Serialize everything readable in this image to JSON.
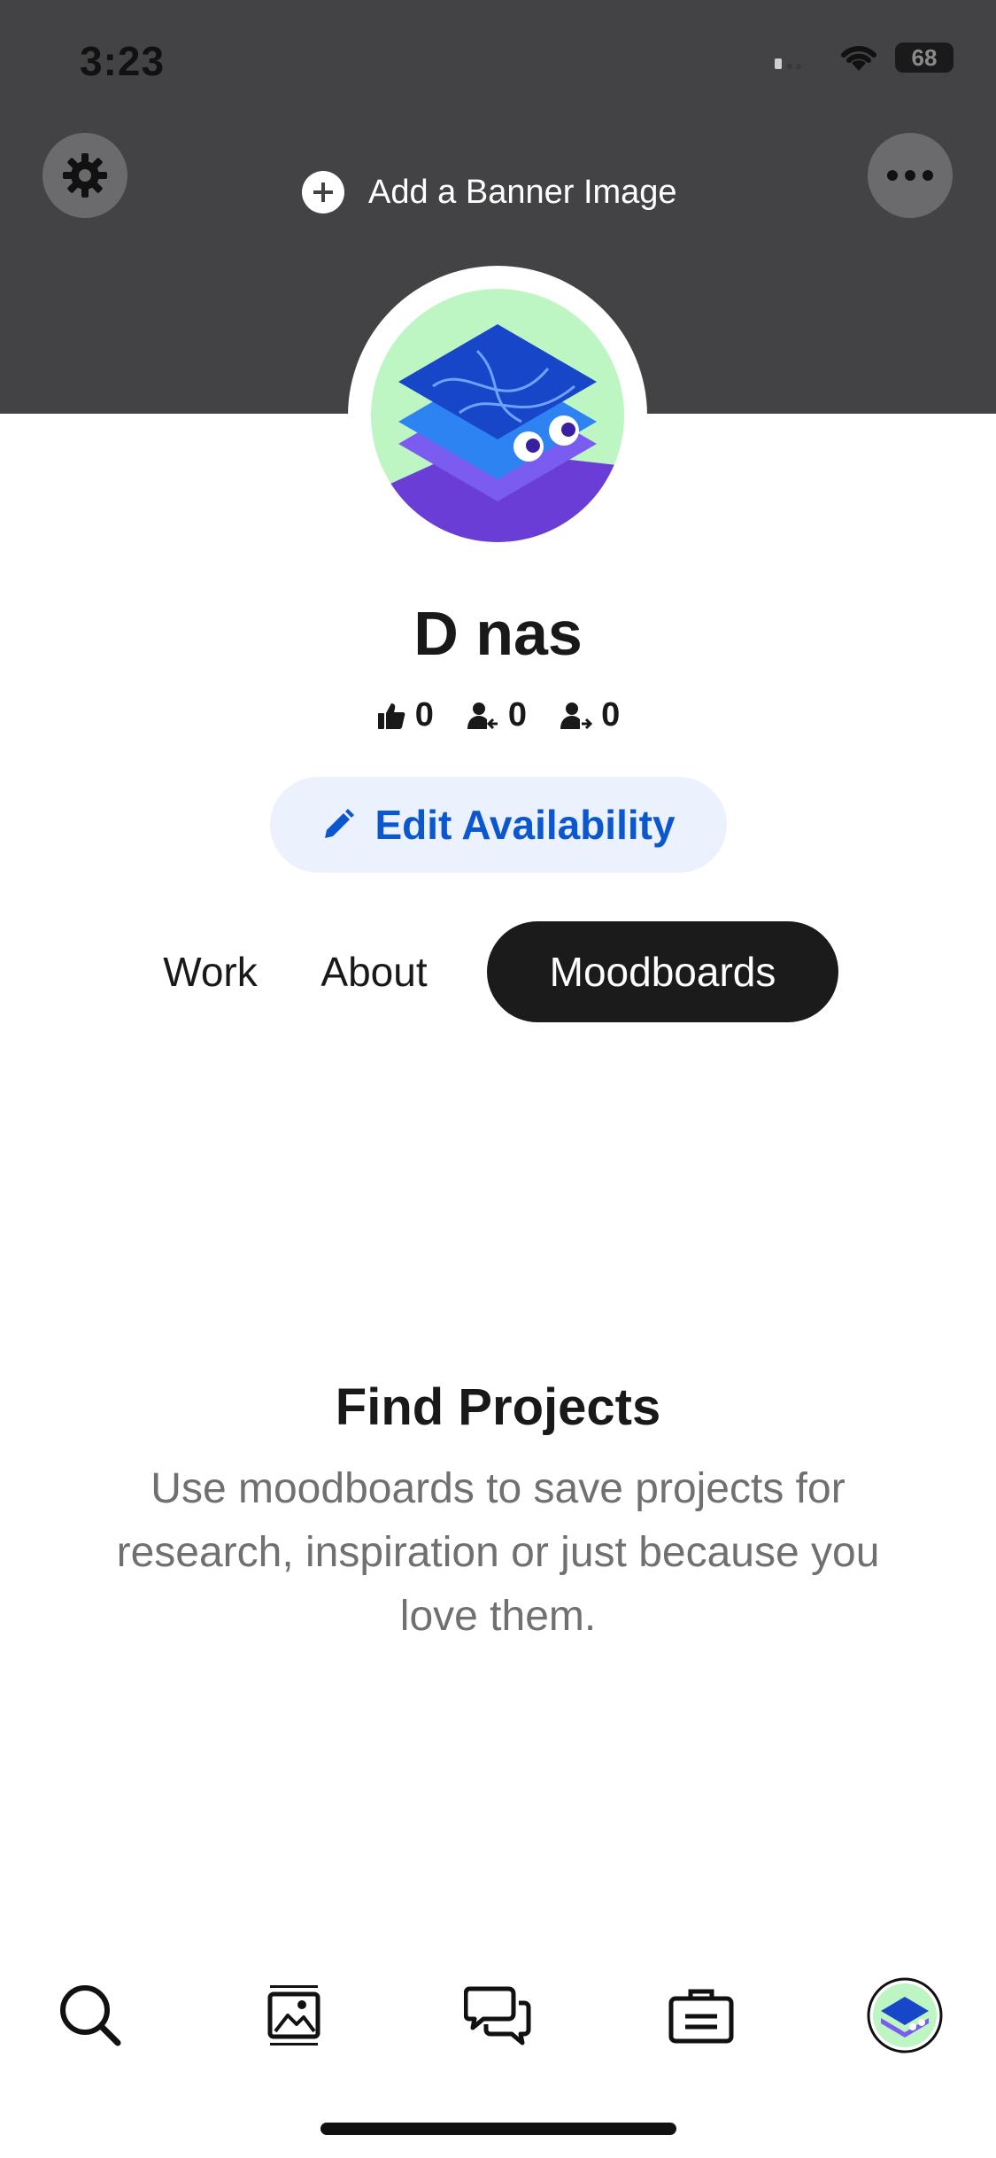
{
  "status_bar": {
    "time": "3:23",
    "battery": "68"
  },
  "banner": {
    "add_label": "Add a Banner Image",
    "settings_icon": "gear-icon",
    "more_icon": "ellipsis-icon"
  },
  "profile": {
    "name": "D nas",
    "stats": {
      "appreciations": "0",
      "followers": "0",
      "following": "0"
    },
    "edit_label": "Edit Availability"
  },
  "tabs": [
    {
      "label": "Work"
    },
    {
      "label": "About"
    },
    {
      "label": "Moodboards",
      "active": true
    }
  ],
  "empty_state": {
    "title": "Find Projects",
    "description": "Use moodboards to save projects for research, inspiration or just because you love them."
  },
  "bottom_nav": [
    {
      "icon": "search-icon"
    },
    {
      "icon": "image-icon"
    },
    {
      "icon": "chat-icon"
    },
    {
      "icon": "briefcase-icon"
    },
    {
      "icon": "avatar-icon"
    }
  ],
  "colors": {
    "banner": "#434345",
    "accent": "#0b57d0",
    "edit_bg": "#ebf1fd",
    "active_tab": "#1b1b1c",
    "avatar_bg": "#bdf5c3"
  }
}
